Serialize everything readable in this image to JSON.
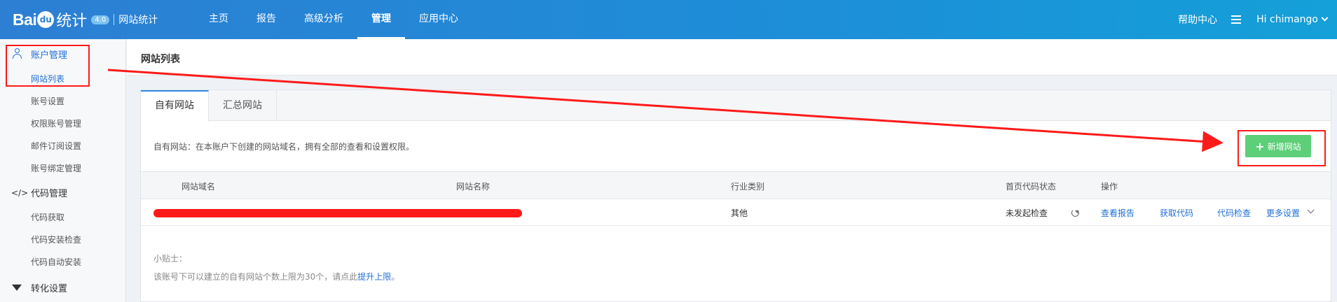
{
  "header": {
    "logo_bai": "Bai",
    "logo_du": "du",
    "logo_tongji": "统计",
    "logo_version": "4.0",
    "logo_site": "网站统计",
    "nav": [
      {
        "label": "主页"
      },
      {
        "label": "报告"
      },
      {
        "label": "高级分析"
      },
      {
        "label": "管理"
      },
      {
        "label": "应用中心"
      }
    ],
    "active_nav": "管理",
    "help": "帮助中心",
    "user": "Hi chimango"
  },
  "sidebar": {
    "account_group": "账户管理",
    "account_items": [
      "网站列表",
      "账号设置",
      "权限账号管理",
      "邮件订阅设置",
      "账号绑定管理"
    ],
    "code_group_icon": "</>",
    "code_group": "代码管理",
    "code_items": [
      "代码获取",
      "代码安装检查",
      "代码自动安装"
    ],
    "convert_group": "转化设置",
    "active_item": "网站列表"
  },
  "page": {
    "title": "网站列表"
  },
  "tabs": [
    {
      "label": "自有网站"
    },
    {
      "label": "汇总网站"
    }
  ],
  "description": "自有网站：在本账户下创建的网站域名，拥有全部的查看和设置权限。",
  "add_button": "新增网站",
  "table": {
    "columns": [
      "网站域名",
      "网站名称",
      "行业类别",
      "首页代码状态",
      "操作"
    ],
    "rows": [
      {
        "industry": "其他",
        "status": "未发起检查",
        "actions": [
          "查看报告",
          "获取代码",
          "代码检查",
          "更多设置"
        ]
      }
    ]
  },
  "tips": {
    "title": "小贴士：",
    "text": "该账号下可以建立的自有网站个数上限为30个，请点此",
    "link": "提升上限",
    "suffix": "。"
  },
  "colors": {
    "header_start": "#2d7fd3",
    "header_end": "#14a0d8",
    "accent": "#1e6fd9",
    "add_button": "#5ccf78",
    "annotation_red": "#ff1a1a"
  }
}
